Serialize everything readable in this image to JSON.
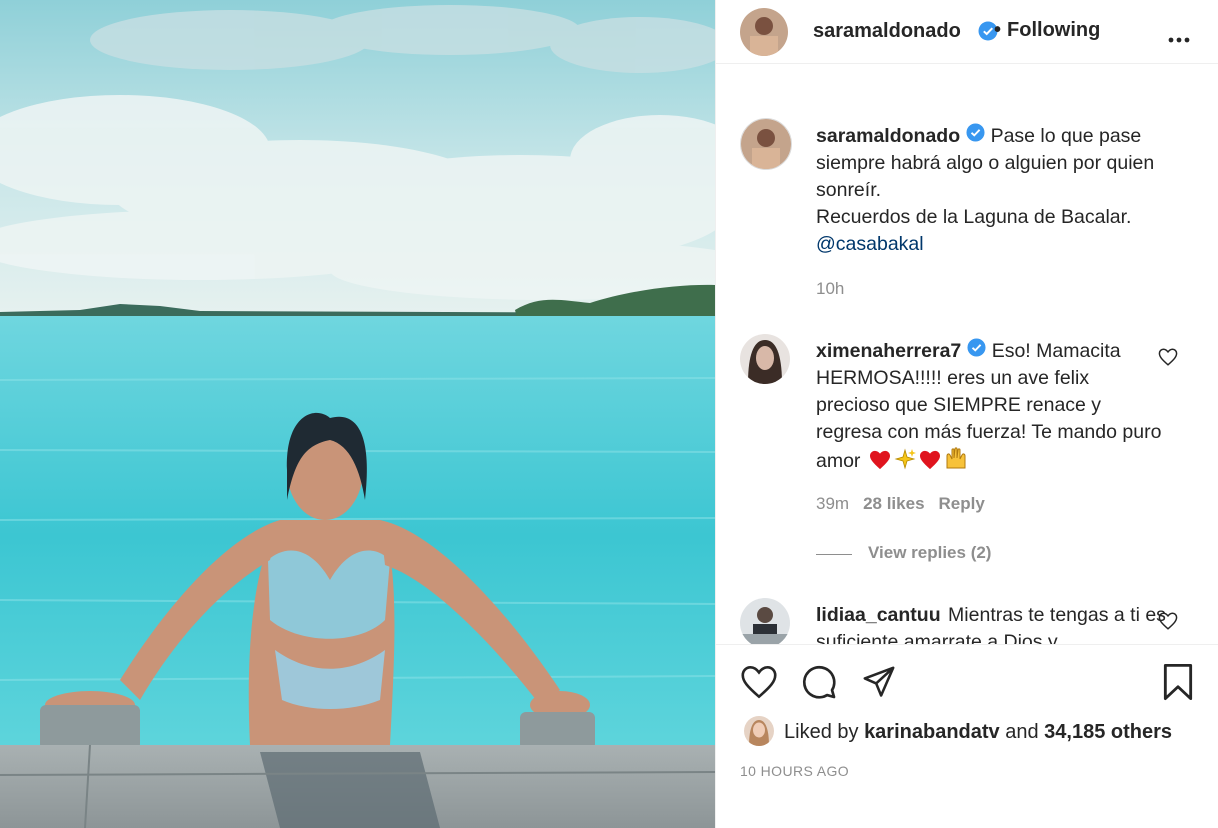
{
  "post": {
    "author": "saramaldonado",
    "follow_status": "Following",
    "caption_line": "Pase lo que pase siempre habrá algo o alguien por quien sonreír.",
    "caption_line2": "Recuerdos de la Laguna de Bacalar.",
    "caption_mention": "@casabakal",
    "caption_time": "10h"
  },
  "comments": [
    {
      "user": "ximenaherrera7",
      "text": "Eso! Mamacita HERMOSA!!!!! eres un ave felix precioso que SIEMPRE renace y regresa con más fuerza! Te mando puro amor",
      "emojis": [
        "red-heart",
        "sparkles",
        "red-heart",
        "raising-hands"
      ],
      "time": "39m",
      "likes": "28 likes",
      "reply_label": "Reply",
      "view_replies": "View replies (2)"
    },
    {
      "user": "lidiaa_cantuu",
      "text": "Mientras te tengas a ti es suficiente amarrate a Dios y"
    }
  ],
  "likes": {
    "prefix": "Liked by",
    "user": "karinabandatv",
    "and": "and",
    "others": "34,185 others"
  },
  "timestamp": "10 HOURS AGO",
  "icons": {
    "verified": "verified-badge-icon",
    "more": "more-options-icon",
    "like": "heart-icon",
    "comment": "comment-icon",
    "share": "send-icon",
    "save": "bookmark-icon"
  },
  "colors": {
    "verified": "#3897f0",
    "text": "#262626",
    "muted": "#8e8e8e",
    "mention": "#00376b",
    "lagoon": "#4fcad6"
  }
}
